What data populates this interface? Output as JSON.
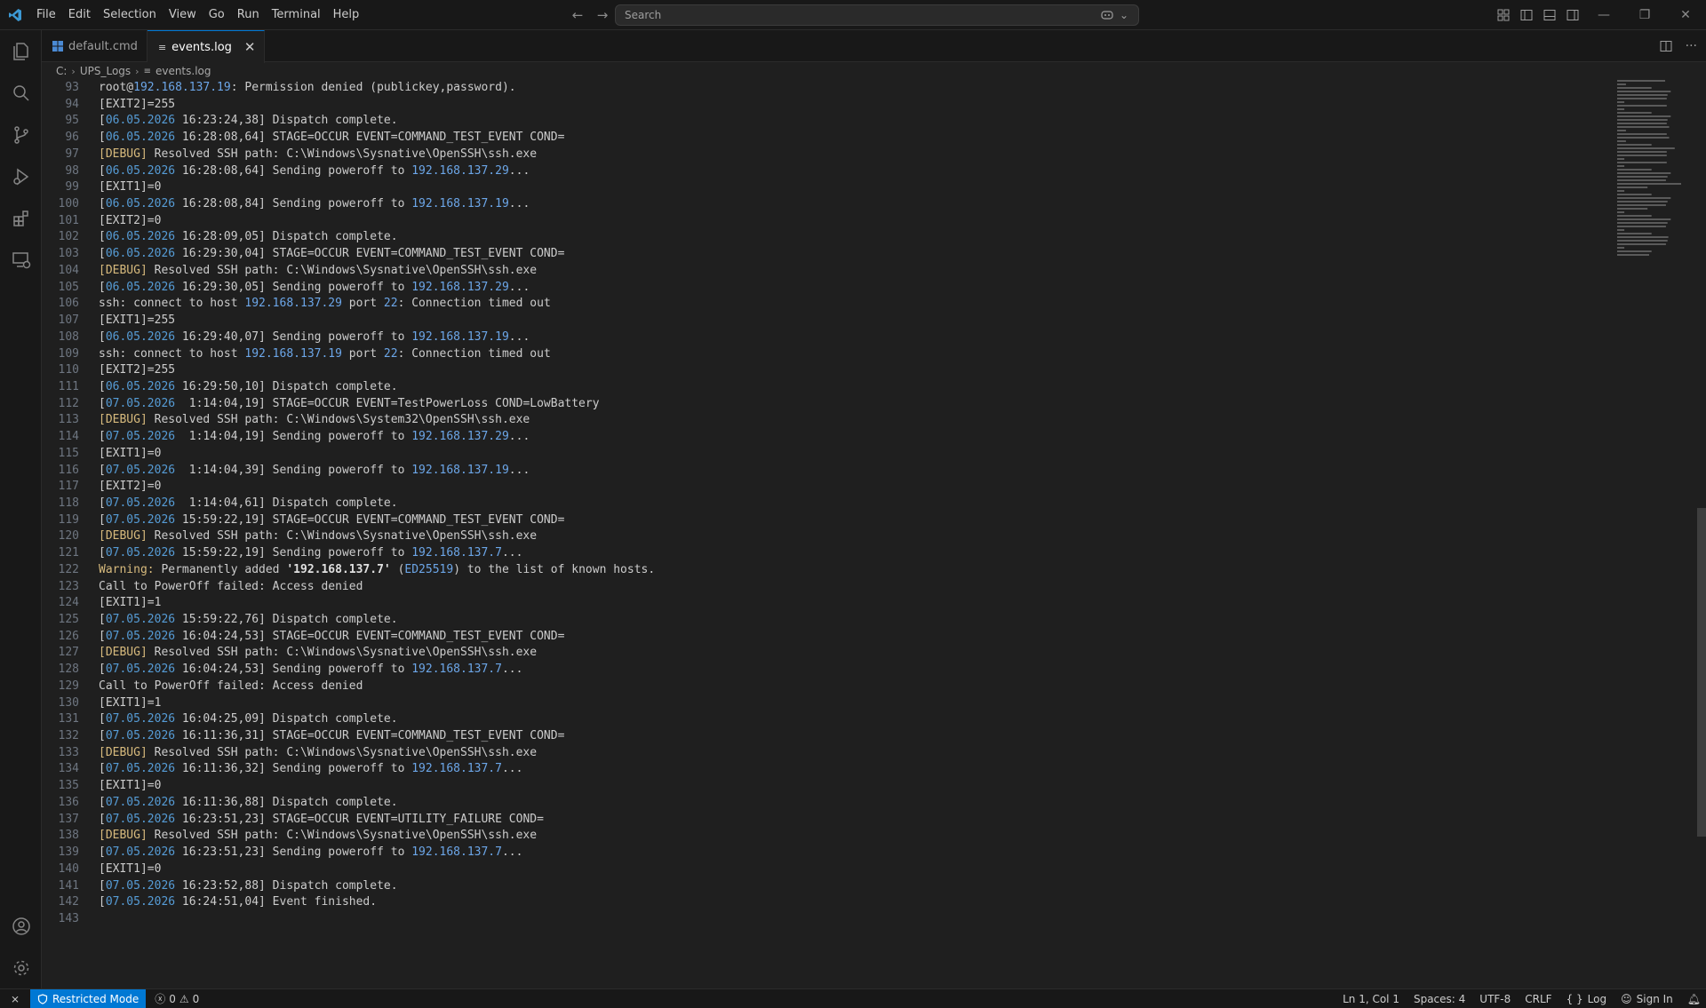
{
  "menu": [
    "File",
    "Edit",
    "Selection",
    "View",
    "Go",
    "Run",
    "Terminal",
    "Help"
  ],
  "search": {
    "placeholder": "Search"
  },
  "tabs": [
    {
      "label": "default.cmd",
      "icon": "windows-cmd-icon",
      "active": false
    },
    {
      "label": "events.log",
      "icon": "log-file-icon",
      "active": true
    }
  ],
  "breadcrumb": {
    "drive": "C:",
    "folder": "UPS_Logs",
    "file": "events.log"
  },
  "lines": [
    {
      "n": "93",
      "parts": [
        [
          "t",
          "root@"
        ],
        [
          "ip",
          "192.168.137.19"
        ],
        [
          "t",
          ": Permission denied (publickey,password)."
        ]
      ]
    },
    {
      "n": "94",
      "parts": [
        [
          "t",
          "[EXIT2]=255"
        ]
      ]
    },
    {
      "n": "95",
      "parts": [
        [
          "t",
          "["
        ],
        [
          "d",
          "06.05.2026"
        ],
        [
          "t",
          " 16:23:24,38] Dispatch complete."
        ]
      ]
    },
    {
      "n": "96",
      "parts": [
        [
          "t",
          "["
        ],
        [
          "d",
          "06.05.2026"
        ],
        [
          "t",
          " 16:28:08,64] STAGE=OCCUR EVENT=COMMAND_TEST_EVENT COND="
        ]
      ]
    },
    {
      "n": "97",
      "parts": [
        [
          "g",
          "[DEBUG]"
        ],
        [
          "t",
          " Resolved SSH path: C:\\Windows\\Sysnative\\OpenSSH\\ssh.exe"
        ]
      ]
    },
    {
      "n": "98",
      "parts": [
        [
          "t",
          "["
        ],
        [
          "d",
          "06.05.2026"
        ],
        [
          "t",
          " 16:28:08,64] Sending poweroff to "
        ],
        [
          "ip",
          "192.168.137.29"
        ],
        [
          "t",
          "..."
        ]
      ]
    },
    {
      "n": "99",
      "parts": [
        [
          "t",
          "[EXIT1]=0"
        ]
      ]
    },
    {
      "n": "100",
      "parts": [
        [
          "t",
          "["
        ],
        [
          "d",
          "06.05.2026"
        ],
        [
          "t",
          " 16:28:08,84] Sending poweroff to "
        ],
        [
          "ip",
          "192.168.137.19"
        ],
        [
          "t",
          "..."
        ]
      ]
    },
    {
      "n": "101",
      "parts": [
        [
          "t",
          "[EXIT2]=0"
        ]
      ]
    },
    {
      "n": "102",
      "parts": [
        [
          "t",
          "["
        ],
        [
          "d",
          "06.05.2026"
        ],
        [
          "t",
          " 16:28:09,05] Dispatch complete."
        ]
      ]
    },
    {
      "n": "103",
      "parts": [
        [
          "t",
          "["
        ],
        [
          "d",
          "06.05.2026"
        ],
        [
          "t",
          " 16:29:30,04] STAGE=OCCUR EVENT=COMMAND_TEST_EVENT COND="
        ]
      ]
    },
    {
      "n": "104",
      "parts": [
        [
          "g",
          "[DEBUG]"
        ],
        [
          "t",
          " Resolved SSH path: C:\\Windows\\Sysnative\\OpenSSH\\ssh.exe"
        ]
      ]
    },
    {
      "n": "105",
      "parts": [
        [
          "t",
          "["
        ],
        [
          "d",
          "06.05.2026"
        ],
        [
          "t",
          " 16:29:30,05] Sending poweroff to "
        ],
        [
          "ip",
          "192.168.137.29"
        ],
        [
          "t",
          "..."
        ]
      ]
    },
    {
      "n": "106",
      "parts": [
        [
          "t",
          "ssh: connect to host "
        ],
        [
          "ip",
          "192.168.137.29"
        ],
        [
          "t",
          " port "
        ],
        [
          "ip",
          "22"
        ],
        [
          "t",
          ": Connection timed out"
        ]
      ]
    },
    {
      "n": "107",
      "parts": [
        [
          "t",
          "[EXIT1]=255"
        ]
      ]
    },
    {
      "n": "108",
      "parts": [
        [
          "t",
          "["
        ],
        [
          "d",
          "06.05.2026"
        ],
        [
          "t",
          " 16:29:40,07] Sending poweroff to "
        ],
        [
          "ip",
          "192.168.137.19"
        ],
        [
          "t",
          "..."
        ]
      ]
    },
    {
      "n": "109",
      "parts": [
        [
          "t",
          "ssh: connect to host "
        ],
        [
          "ip",
          "192.168.137.19"
        ],
        [
          "t",
          " port "
        ],
        [
          "ip",
          "22"
        ],
        [
          "t",
          ": Connection timed out"
        ]
      ]
    },
    {
      "n": "110",
      "parts": [
        [
          "t",
          "[EXIT2]=255"
        ]
      ]
    },
    {
      "n": "111",
      "parts": [
        [
          "t",
          "["
        ],
        [
          "d",
          "06.05.2026"
        ],
        [
          "t",
          " 16:29:50,10] Dispatch complete."
        ]
      ]
    },
    {
      "n": "112",
      "parts": [
        [
          "t",
          "["
        ],
        [
          "d",
          "07.05.2026"
        ],
        [
          "t",
          "  1:14:04,19] STAGE=OCCUR EVENT=TestPowerLoss COND=LowBattery"
        ]
      ]
    },
    {
      "n": "113",
      "parts": [
        [
          "g",
          "[DEBUG]"
        ],
        [
          "t",
          " Resolved SSH path: C:\\Windows\\System32\\OpenSSH\\ssh.exe"
        ]
      ]
    },
    {
      "n": "114",
      "parts": [
        [
          "t",
          "["
        ],
        [
          "d",
          "07.05.2026"
        ],
        [
          "t",
          "  1:14:04,19] Sending poweroff to "
        ],
        [
          "ip",
          "192.168.137.29"
        ],
        [
          "t",
          "..."
        ]
      ]
    },
    {
      "n": "115",
      "parts": [
        [
          "t",
          "[EXIT1]=0"
        ]
      ]
    },
    {
      "n": "116",
      "parts": [
        [
          "t",
          "["
        ],
        [
          "d",
          "07.05.2026"
        ],
        [
          "t",
          "  1:14:04,39] Sending poweroff to "
        ],
        [
          "ip",
          "192.168.137.19"
        ],
        [
          "t",
          "..."
        ]
      ]
    },
    {
      "n": "117",
      "parts": [
        [
          "t",
          "[EXIT2]=0"
        ]
      ]
    },
    {
      "n": "118",
      "parts": [
        [
          "t",
          "["
        ],
        [
          "d",
          "07.05.2026"
        ],
        [
          "t",
          "  1:14:04,61] Dispatch complete."
        ]
      ]
    },
    {
      "n": "119",
      "parts": [
        [
          "t",
          "["
        ],
        [
          "d",
          "07.05.2026"
        ],
        [
          "t",
          " 15:59:22,19] STAGE=OCCUR EVENT=COMMAND_TEST_EVENT COND="
        ]
      ]
    },
    {
      "n": "120",
      "parts": [
        [
          "g",
          "[DEBUG]"
        ],
        [
          "t",
          " Resolved SSH path: C:\\Windows\\Sysnative\\OpenSSH\\ssh.exe"
        ]
      ]
    },
    {
      "n": "121",
      "parts": [
        [
          "t",
          "["
        ],
        [
          "d",
          "07.05.2026"
        ],
        [
          "t",
          " 15:59:22,19] Sending poweroff to "
        ],
        [
          "ip",
          "192.168.137.7"
        ],
        [
          "t",
          "..."
        ]
      ]
    },
    {
      "n": "122",
      "parts": [
        [
          "w",
          "Warning:"
        ],
        [
          "t",
          " Permanently added "
        ],
        [
          "s",
          "'192.168.137.7'"
        ],
        [
          "t",
          " ("
        ],
        [
          "ip",
          "ED25519"
        ],
        [
          "t",
          ") to the list of known hosts."
        ]
      ]
    },
    {
      "n": "123",
      "parts": [
        [
          "t",
          "Call to PowerOff failed: Access denied"
        ]
      ]
    },
    {
      "n": "124",
      "parts": [
        [
          "t",
          "[EXIT1]=1"
        ]
      ]
    },
    {
      "n": "125",
      "parts": [
        [
          "t",
          "["
        ],
        [
          "d",
          "07.05.2026"
        ],
        [
          "t",
          " 15:59:22,76] Dispatch complete."
        ]
      ]
    },
    {
      "n": "126",
      "parts": [
        [
          "t",
          "["
        ],
        [
          "d",
          "07.05.2026"
        ],
        [
          "t",
          " 16:04:24,53] STAGE=OCCUR EVENT=COMMAND_TEST_EVENT COND="
        ]
      ]
    },
    {
      "n": "127",
      "parts": [
        [
          "g",
          "[DEBUG]"
        ],
        [
          "t",
          " Resolved SSH path: C:\\Windows\\Sysnative\\OpenSSH\\ssh.exe"
        ]
      ]
    },
    {
      "n": "128",
      "parts": [
        [
          "t",
          "["
        ],
        [
          "d",
          "07.05.2026"
        ],
        [
          "t",
          " 16:04:24,53] Sending poweroff to "
        ],
        [
          "ip",
          "192.168.137.7"
        ],
        [
          "t",
          "..."
        ]
      ]
    },
    {
      "n": "129",
      "parts": [
        [
          "t",
          "Call to PowerOff failed: Access denied"
        ]
      ]
    },
    {
      "n": "130",
      "parts": [
        [
          "t",
          "[EXIT1]=1"
        ]
      ]
    },
    {
      "n": "131",
      "parts": [
        [
          "t",
          "["
        ],
        [
          "d",
          "07.05.2026"
        ],
        [
          "t",
          " 16:04:25,09] Dispatch complete."
        ]
      ]
    },
    {
      "n": "132",
      "parts": [
        [
          "t",
          "["
        ],
        [
          "d",
          "07.05.2026"
        ],
        [
          "t",
          " 16:11:36,31] STAGE=OCCUR EVENT=COMMAND_TEST_EVENT COND="
        ]
      ]
    },
    {
      "n": "133",
      "parts": [
        [
          "g",
          "[DEBUG]"
        ],
        [
          "t",
          " Resolved SSH path: C:\\Windows\\Sysnative\\OpenSSH\\ssh.exe"
        ]
      ]
    },
    {
      "n": "134",
      "parts": [
        [
          "t",
          "["
        ],
        [
          "d",
          "07.05.2026"
        ],
        [
          "t",
          " 16:11:36,32] Sending poweroff to "
        ],
        [
          "ip",
          "192.168.137.7"
        ],
        [
          "t",
          "..."
        ]
      ]
    },
    {
      "n": "135",
      "parts": [
        [
          "t",
          "[EXIT1]=0"
        ]
      ]
    },
    {
      "n": "136",
      "parts": [
        [
          "t",
          "["
        ],
        [
          "d",
          "07.05.2026"
        ],
        [
          "t",
          " 16:11:36,88] Dispatch complete."
        ]
      ]
    },
    {
      "n": "137",
      "parts": [
        [
          "t",
          "["
        ],
        [
          "d",
          "07.05.2026"
        ],
        [
          "t",
          " 16:23:51,23] STAGE=OCCUR EVENT=UTILITY_FAILURE COND="
        ]
      ]
    },
    {
      "n": "138",
      "parts": [
        [
          "g",
          "[DEBUG]"
        ],
        [
          "t",
          " Resolved SSH path: C:\\Windows\\Sysnative\\OpenSSH\\ssh.exe"
        ]
      ]
    },
    {
      "n": "139",
      "parts": [
        [
          "t",
          "["
        ],
        [
          "d",
          "07.05.2026"
        ],
        [
          "t",
          " 16:23:51,23] Sending poweroff to "
        ],
        [
          "ip",
          "192.168.137.7"
        ],
        [
          "t",
          "..."
        ]
      ]
    },
    {
      "n": "140",
      "parts": [
        [
          "t",
          "[EXIT1]=0"
        ]
      ]
    },
    {
      "n": "141",
      "parts": [
        [
          "t",
          "["
        ],
        [
          "d",
          "07.05.2026"
        ],
        [
          "t",
          " 16:23:52,88] Dispatch complete."
        ]
      ]
    },
    {
      "n": "142",
      "parts": [
        [
          "t",
          "["
        ],
        [
          "d",
          "07.05.2026"
        ],
        [
          "t",
          " 16:24:51,04] Event finished."
        ]
      ]
    },
    {
      "n": "143",
      "parts": []
    }
  ],
  "status": {
    "restricted": "Restricted Mode",
    "errors": "0",
    "warnings": "0",
    "position": "Ln 1, Col 1",
    "spaces": "Spaces: 4",
    "encoding": "UTF-8",
    "eol": "CRLF",
    "language": "Log",
    "signin": "Sign In"
  },
  "colors": {
    "accent": "#0078d4",
    "date": "#569cd6",
    "ip": "#6ca6e8",
    "debug": "#d7ba7d"
  }
}
